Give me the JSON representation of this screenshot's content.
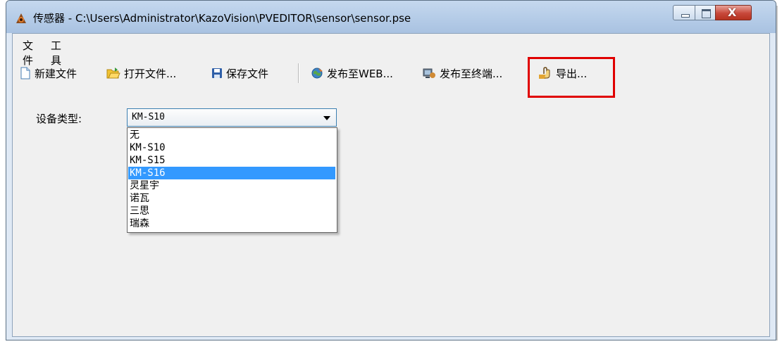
{
  "window": {
    "title": "传感器 - C:\\Users\\Administrator\\KazoVision\\PVEDITOR\\sensor\\sensor.pse",
    "app_icon": "sensor-app-icon",
    "controls": {
      "minimize": "minimize",
      "maximize": "maximize",
      "close": "X"
    }
  },
  "menu": [
    {
      "label": "文件"
    },
    {
      "label": "工具"
    }
  ],
  "toolbar": {
    "new_file": {
      "label": "新建文件",
      "icon": "new-file-icon"
    },
    "open_file": {
      "label": "打开文件...",
      "icon": "open-folder-icon"
    },
    "save_file": {
      "label": "保存文件",
      "icon": "save-disk-icon"
    },
    "publish_web": {
      "label": "发布至WEB...",
      "icon": "globe-icon"
    },
    "publish_terminal": {
      "label": "发布至终端...",
      "icon": "terminal-icon"
    },
    "export": {
      "label": "导出...",
      "icon": "export-icon"
    }
  },
  "device": {
    "label": "设备类型:",
    "selected": "KM-S10",
    "options": [
      "无",
      "KM-S10",
      "KM-S15",
      "KM-S16",
      "灵星宇",
      "诺瓦",
      "三思",
      "瑞森"
    ],
    "highlighted_index": 3
  },
  "colors": {
    "highlight_box": "#e00000",
    "selection": "#3399ff"
  }
}
